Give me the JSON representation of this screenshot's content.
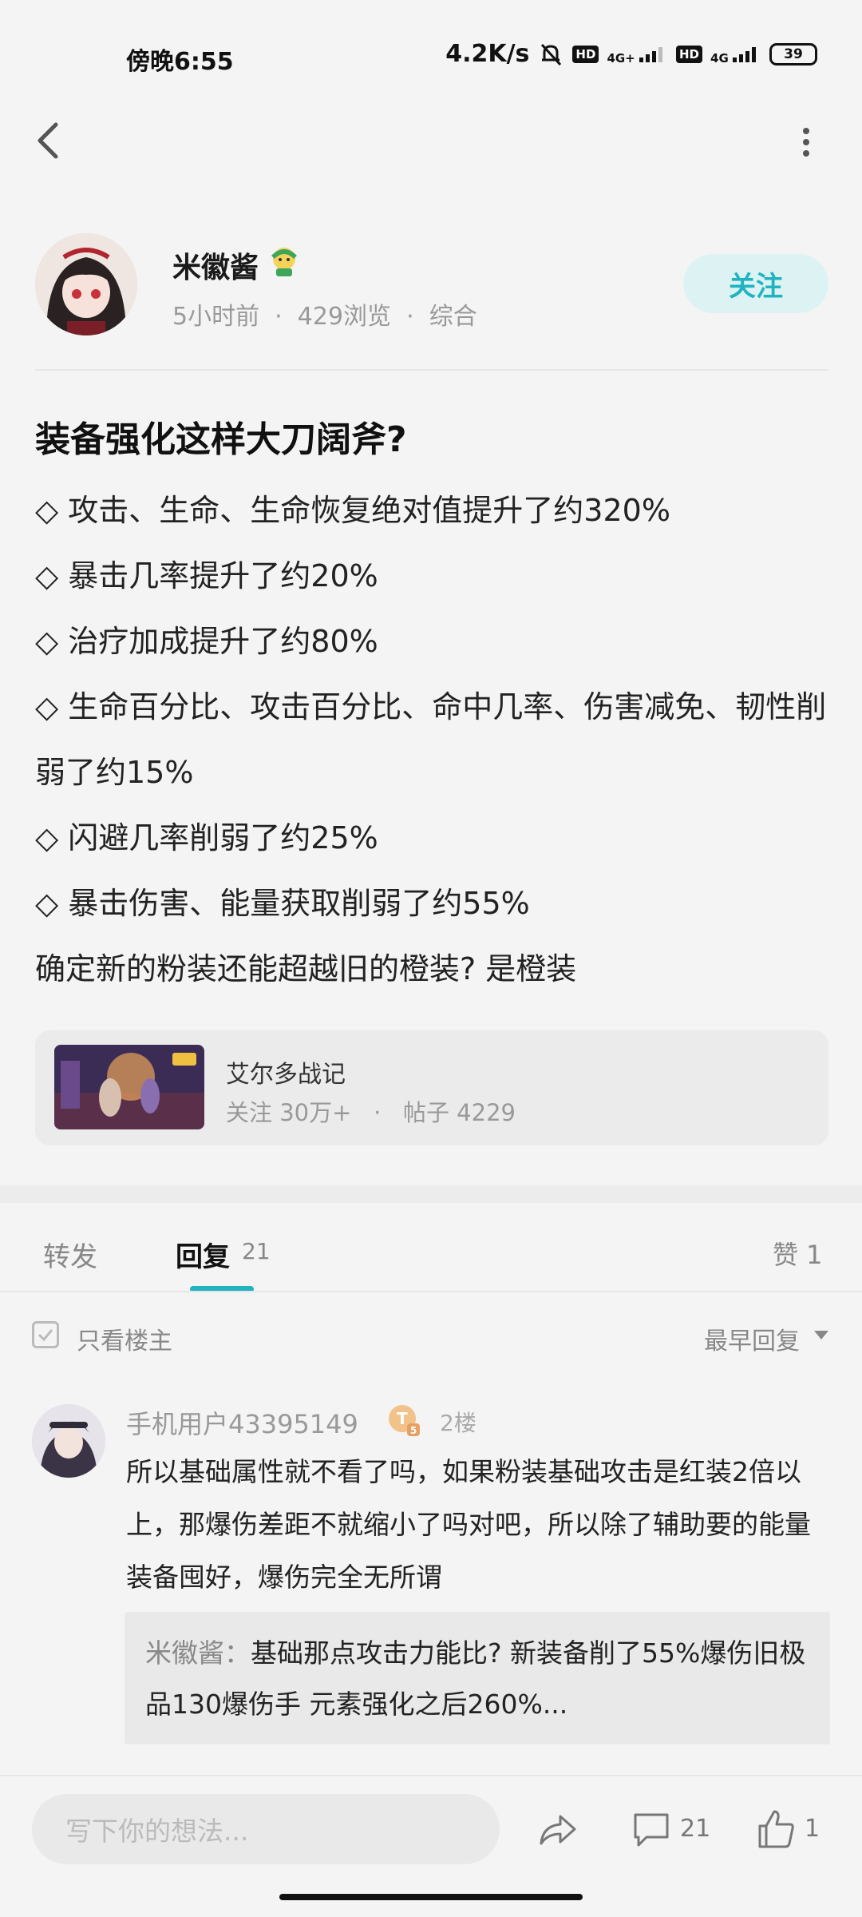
{
  "status": {
    "time": "傍晚6:55",
    "speed": "4.2K/s",
    "sim1_net": "4G+",
    "sim2_net": "4G",
    "hd": "HD",
    "battery": "39"
  },
  "post": {
    "author": "米徽酱",
    "meta": {
      "time": "5小时前",
      "views": "429浏览",
      "category": "综合"
    },
    "follow_label": "关注",
    "title": "装备强化这样大刀阔斧?",
    "lines": [
      "◇ 攻击、生命、生命恢复绝对值提升了约320%",
      "◇ 暴击几率提升了约20%",
      "◇ 治疗加成提升了约80%",
      "◇ 生命百分比、攻击百分比、命中几率、伤害减免、韧性削弱了约15%",
      "◇ 闪避几率削弱了约25%",
      "◇ 暴击伤害、能量获取削弱了约55%",
      "确定新的粉装还能超越旧的橙装? 是橙装"
    ]
  },
  "forum": {
    "name": "艾尔多战记",
    "followers": "关注 30万+",
    "posts": "帖子 4229"
  },
  "tabs": {
    "repost": "转发",
    "reply": "回复",
    "reply_count": "21",
    "like": "赞 1"
  },
  "filter": {
    "only_op": "只看楼主",
    "sort": "最早回复"
  },
  "comment": {
    "user": "手机用户43395149",
    "floor": "2楼",
    "text": "所以基础属性就不看了吗，如果粉装基础攻击是红装2倍以上，那爆伤差距不就缩小了吗对吧，所以除了辅助要的能量装备囤好，爆伤完全无所谓",
    "reply_author": "米徽酱：",
    "reply_text": "基础那点攻击力能比? 新装备削了55%爆伤旧极品130爆伤手 元素强化之后260%..."
  },
  "bottom": {
    "input_placeholder": "写下你的想法...",
    "comment_count": "21",
    "like_count": "1"
  },
  "colors": {
    "accent": "#21b3c0",
    "follow_bg": "#ddf3f3"
  }
}
